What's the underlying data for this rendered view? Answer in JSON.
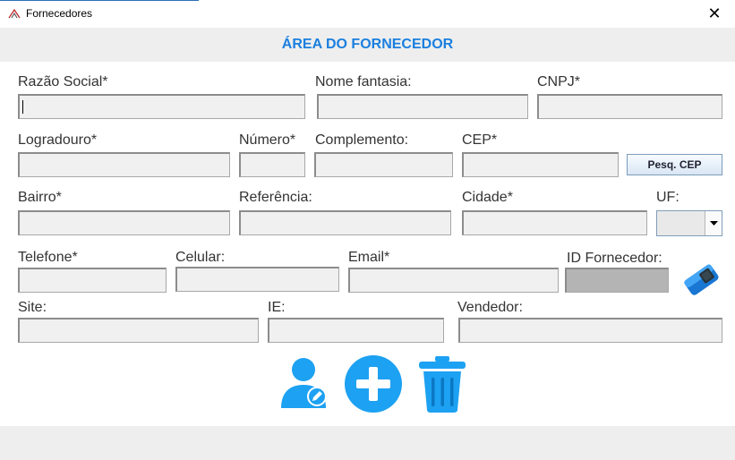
{
  "window": {
    "title": "Fornecedores",
    "close_glyph": "✕"
  },
  "header": {
    "title": "ÁREA DO FORNECEDOR"
  },
  "form": {
    "razao_social": {
      "label": "Razão Social*",
      "value": ""
    },
    "nome_fantasia": {
      "label": "Nome fantasia:",
      "value": ""
    },
    "cnpj": {
      "label": "CNPJ*",
      "value": ""
    },
    "logradouro": {
      "label": "Logradouro*",
      "value": ""
    },
    "numero": {
      "label": "Número*",
      "value": ""
    },
    "complemento": {
      "label": "Complemento:",
      "value": ""
    },
    "cep": {
      "label": "CEP*",
      "value": ""
    },
    "bairro": {
      "label": "Bairro*",
      "value": ""
    },
    "referencia": {
      "label": "Referência:",
      "value": ""
    },
    "cidade": {
      "label": "Cidade*",
      "value": ""
    },
    "uf": {
      "label": "UF:",
      "value": ""
    },
    "telefone": {
      "label": "Telefone*",
      "value": ""
    },
    "celular": {
      "label": "Celular:",
      "value": ""
    },
    "email": {
      "label": "Email*",
      "value": ""
    },
    "id_fornecedor": {
      "label": "ID Fornecedor:",
      "value": ""
    },
    "site": {
      "label": "Site:",
      "value": ""
    },
    "ie": {
      "label": "IE:",
      "value": ""
    },
    "vendedor": {
      "label": "Vendedor:",
      "value": ""
    }
  },
  "buttons": {
    "pesquisar_cep": "Pesq. CEP"
  },
  "icons": {
    "app": "app-logo-icon",
    "clear": "eraser-icon",
    "edit": "user-edit-icon",
    "add": "plus-circle-icon",
    "delete": "trash-icon"
  },
  "colors": {
    "accent": "#1a7fdf",
    "icon_blue": "#1da1f2",
    "field_bg": "#f0f0f0",
    "readonly_field_bg": "#b4b4b4"
  }
}
